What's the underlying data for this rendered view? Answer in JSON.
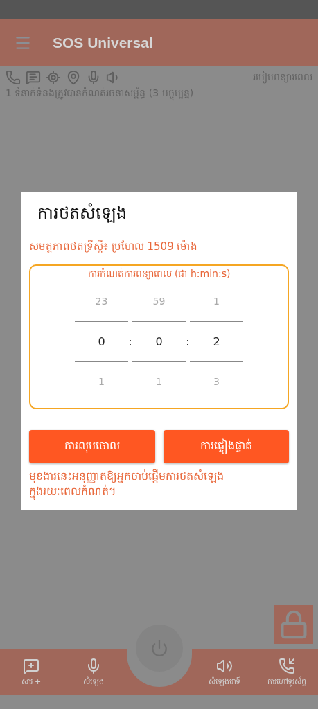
{
  "app_bar": {
    "title": "SOS Universal"
  },
  "schedule_label": "របៀបពន្យារពេល",
  "contacts_info": "1 ទំនាក់ទំនងត្រូវបានកំណត់រចនាសម្ព័ន្ធ (3 បច្ចុប្បន្ន)",
  "dialog": {
    "title": "ការថតសំឡេង",
    "capacity": "សមត្ថភាពថតទ្រីស្តី៖ ប្រហែល 1509 ម៉ោង",
    "picker": {
      "label": "ការកំណត់ការពន្យាពេល (ជា h:min:s)",
      "columns": [
        {
          "above": "23",
          "value": "0",
          "below": "1"
        },
        {
          "above": "59",
          "value": "0",
          "below": "1"
        },
        {
          "above": "1",
          "value": "2",
          "below": "3"
        }
      ],
      "separators": [
        ":",
        ":"
      ]
    },
    "buttons": [
      "ការលុបចោល",
      "ការផ្ទៀងផ្ទាត់"
    ],
    "note": "មុខងារនេះអនុញ្ញាតឱ្យអ្នកចាប់ផ្តើមការថតសំឡេងក្នុងរយៈពេលកំណត់។"
  },
  "bottom_nav": [
    {
      "label": "សារ +"
    },
    {
      "label": "សំឡេង"
    },
    {
      "label": "សំឡេងរោទ៍"
    },
    {
      "label": "ការហៅទូរស័ព្ទ"
    }
  ]
}
